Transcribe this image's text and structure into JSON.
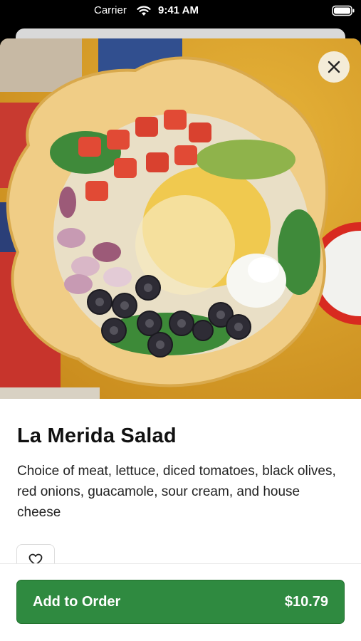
{
  "status_bar": {
    "carrier": "Carrier",
    "time": "9:41 AM"
  },
  "item": {
    "image_alt": "Taco salad in a fried tortilla bowl",
    "name": "La Merida Salad",
    "description": "Choice of meat, lettuce, diced tomatoes, black olives, red onions, guacamole, sour cream, and house cheese"
  },
  "actions": {
    "add_label": "Add to Order",
    "price": "$10.79"
  },
  "icons": {
    "close": "close-icon",
    "favorite": "heart-outline-icon",
    "wifi": "wifi-icon",
    "battery": "battery-icon"
  },
  "colors": {
    "primary": "#2f8a40",
    "background": "#ffffff",
    "text": "#111111"
  }
}
